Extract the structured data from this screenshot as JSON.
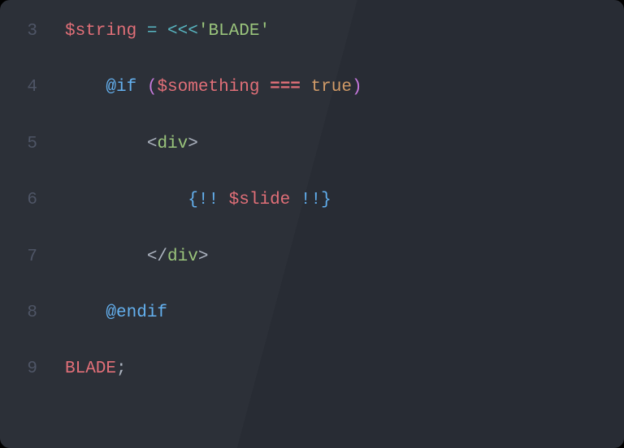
{
  "lines": [
    {
      "num": "3",
      "indent": "",
      "tokens": [
        {
          "cls": "t-var",
          "text": "$string"
        },
        {
          "cls": "t-punc",
          "text": " "
        },
        {
          "cls": "t-op",
          "text": "="
        },
        {
          "cls": "t-punc",
          "text": " "
        },
        {
          "cls": "t-op",
          "text": "<<<"
        },
        {
          "cls": "t-str",
          "text": "'BLADE'"
        }
      ]
    },
    {
      "num": "4",
      "indent": "    ",
      "tokens": [
        {
          "cls": "t-dir",
          "text": "@if"
        },
        {
          "cls": "t-punc",
          "text": " "
        },
        {
          "cls": "t-paren",
          "text": "("
        },
        {
          "cls": "t-var",
          "text": "$something"
        },
        {
          "cls": "t-punc",
          "text": " "
        },
        {
          "cls": "t-eq",
          "text": "==="
        },
        {
          "cls": "t-punc",
          "text": " "
        },
        {
          "cls": "t-bool",
          "text": "true"
        },
        {
          "cls": "t-paren",
          "text": ")"
        }
      ]
    },
    {
      "num": "5",
      "indent": "        ",
      "tokens": [
        {
          "cls": "t-tagbr",
          "text": "<"
        },
        {
          "cls": "t-tag",
          "text": "div"
        },
        {
          "cls": "t-tagbr",
          "text": ">"
        }
      ]
    },
    {
      "num": "6",
      "indent": "            ",
      "tokens": [
        {
          "cls": "t-bldbr",
          "text": "{!!"
        },
        {
          "cls": "t-punc",
          "text": " "
        },
        {
          "cls": "t-var",
          "text": "$slide"
        },
        {
          "cls": "t-punc",
          "text": " "
        },
        {
          "cls": "t-bldbr",
          "text": "!!}"
        }
      ]
    },
    {
      "num": "7",
      "indent": "        ",
      "tokens": [
        {
          "cls": "t-tagbr",
          "text": "</"
        },
        {
          "cls": "t-tag",
          "text": "div"
        },
        {
          "cls": "t-tagbr",
          "text": ">"
        }
      ]
    },
    {
      "num": "8",
      "indent": "    ",
      "tokens": [
        {
          "cls": "t-dir",
          "text": "@endif"
        }
      ]
    },
    {
      "num": "9",
      "indent": "",
      "tokens": [
        {
          "cls": "t-here",
          "text": "BLADE"
        },
        {
          "cls": "t-punc",
          "text": ";"
        }
      ]
    }
  ]
}
